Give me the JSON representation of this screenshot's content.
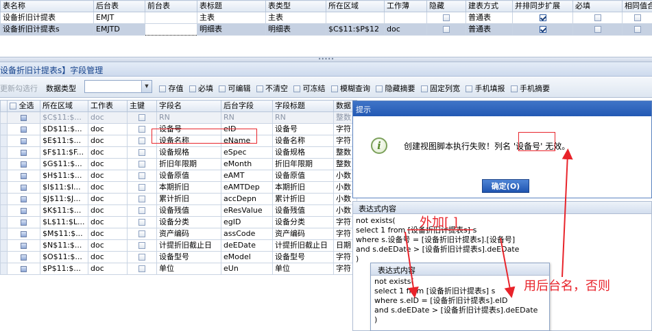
{
  "top": {
    "headers": [
      "表名称",
      "后台表",
      "前台表",
      "表标题",
      "表类型",
      "所在区域",
      "工作薄",
      "隐藏",
      "建表方式",
      "并排同步扩展",
      "必填",
      "相同值合"
    ],
    "rows": [
      [
        "设备折旧计提表",
        "EMJT",
        "",
        "主表",
        "主表",
        "",
        "",
        "",
        "普通表",
        "",
        "",
        ""
      ],
      [
        "设备折旧计提表s",
        "EMJTD",
        "",
        "明细表",
        "明细表",
        "$C$11:$P$12",
        "doc",
        "",
        "普通表",
        "",
        "",
        ""
      ]
    ]
  },
  "splitter": {
    "grip": "•••••"
  },
  "panel": {
    "title": "设备折旧计提表s】字段管理"
  },
  "toolbar": {
    "refresh": "更新勾选行",
    "type_label": "数据类型",
    "type_value": "",
    "options": [
      "存值",
      "必填",
      "可编辑",
      "不清空",
      "可冻结",
      "模糊查询",
      "隐藏摘要",
      "固定列宽",
      "手机填报",
      "手机摘要"
    ]
  },
  "grid": {
    "headers": [
      "全选",
      "所在区域",
      "工作表",
      "主键",
      "字段名",
      "后台字段",
      "字段标题",
      "数据"
    ],
    "rows": [
      [
        "$C$11:$...",
        "doc",
        "RN",
        "RN",
        "RN",
        "整数"
      ],
      [
        "$D$11:$...",
        "doc",
        "设备号",
        "eID",
        "设备号",
        "字符"
      ],
      [
        "$E$11:$...",
        "doc",
        "设备名称",
        "eName",
        "设备名称",
        "字符"
      ],
      [
        "$F$11:$F...",
        "doc",
        "设备规格",
        "eSpec",
        "设备规格",
        "整数"
      ],
      [
        "$G$11:$...",
        "doc",
        "折旧年限期",
        "eMonth",
        "折旧年限期",
        "整数"
      ],
      [
        "$H$11:$...",
        "doc",
        "设备原值",
        "eAMT",
        "设备原值",
        "小数"
      ],
      [
        "$I$11:$I...",
        "doc",
        "本期折旧",
        "eAMTDep",
        "本期折旧",
        "小数"
      ],
      [
        "$J$11:$J...",
        "doc",
        "累计折旧",
        "accDepn",
        "累计折旧",
        "小数"
      ],
      [
        "$K$11:$...",
        "doc",
        "设备残值",
        "eResValue",
        "设备残值",
        "小数"
      ],
      [
        "$L$11:$L...",
        "doc",
        "设备分类",
        "egID",
        "设备分类",
        "字符"
      ],
      [
        "$M$11:$...",
        "doc",
        "资产编码",
        "assCode",
        "资产编码",
        "字符"
      ],
      [
        "$N$11:$...",
        "doc",
        "计提折旧截止日",
        "deEDate",
        "计提折旧截止日",
        "日期"
      ],
      [
        "$O$11:$...",
        "doc",
        "设备型号",
        "eModel",
        "设备型号",
        "字符"
      ],
      [
        "$P$11:$...",
        "doc",
        "单位",
        "eUn",
        "单位",
        "字符"
      ]
    ]
  },
  "dialog": {
    "title": "提示",
    "message": "创建视图脚本执行失败！列名 '设备号' 无效。",
    "ok": "确定(O)"
  },
  "expr1": {
    "title": "表达式内容",
    "lines": [
      "not exists(",
      "select 1 from [设备折旧计提表s] s",
      "where s.设备号 = [设备折旧计提表s].[设备号]",
      "and s.deEDate > [设备折旧计提表s].deEDate",
      ")"
    ]
  },
  "expr2": {
    "title": "表达式内容",
    "lines": [
      "not exists(",
      "select 1 from [设备折旧计提表s] s",
      "where s.eID = [设备折旧计提表s].eID",
      "and s.deEDate > [设备折旧计提表s].deEDate",
      ")"
    ]
  },
  "annotations": {
    "add_brackets": "外加[ ]",
    "use_backend": "用后台名，否则"
  },
  "colors": {
    "accent": "#2b5fb0",
    "annotation": "#e8232a"
  }
}
